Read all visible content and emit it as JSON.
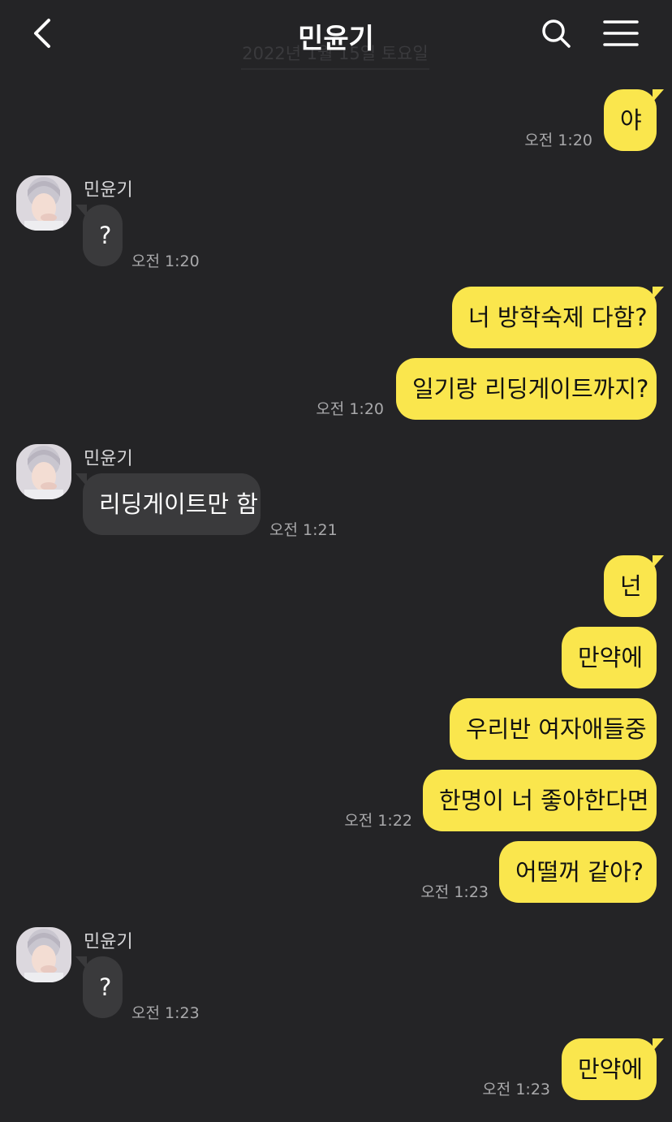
{
  "header": {
    "title": "민윤기",
    "date_divider": "2022년 1월 15일 토요일",
    "back_icon": "chevron-left-icon",
    "search_icon": "search-icon",
    "menu_icon": "hamburger-menu-icon"
  },
  "colors": {
    "background": "#242426",
    "my_bubble": "#fae64d",
    "their_bubble": "#3a3a3c",
    "timestamp": "#a9a9ab"
  },
  "contact": {
    "name": "민윤기"
  },
  "messages": [
    {
      "from": "me",
      "text": "야",
      "time": "오전 1:20"
    },
    {
      "from": "them",
      "text": "?",
      "time": "오전 1:20"
    },
    {
      "from": "me",
      "text": "너 방학숙제 다함?",
      "time": ""
    },
    {
      "from": "me",
      "text": "일기랑 리딩게이트까지?",
      "time": "오전 1:20"
    },
    {
      "from": "them",
      "text": "리딩게이트만 함",
      "time": "오전 1:21"
    },
    {
      "from": "me",
      "text": "넌",
      "time": ""
    },
    {
      "from": "me",
      "text": "만약에",
      "time": ""
    },
    {
      "from": "me",
      "text": "우리반 여자애들중",
      "time": ""
    },
    {
      "from": "me",
      "text": "한명이 너 좋아한다면",
      "time": "오전 1:22"
    },
    {
      "from": "me",
      "text": "어떨꺼 같아?",
      "time": "오전 1:23"
    },
    {
      "from": "them",
      "text": "?",
      "time": "오전 1:23"
    },
    {
      "from": "me",
      "text": "만약에",
      "time": "오전 1:23"
    }
  ]
}
